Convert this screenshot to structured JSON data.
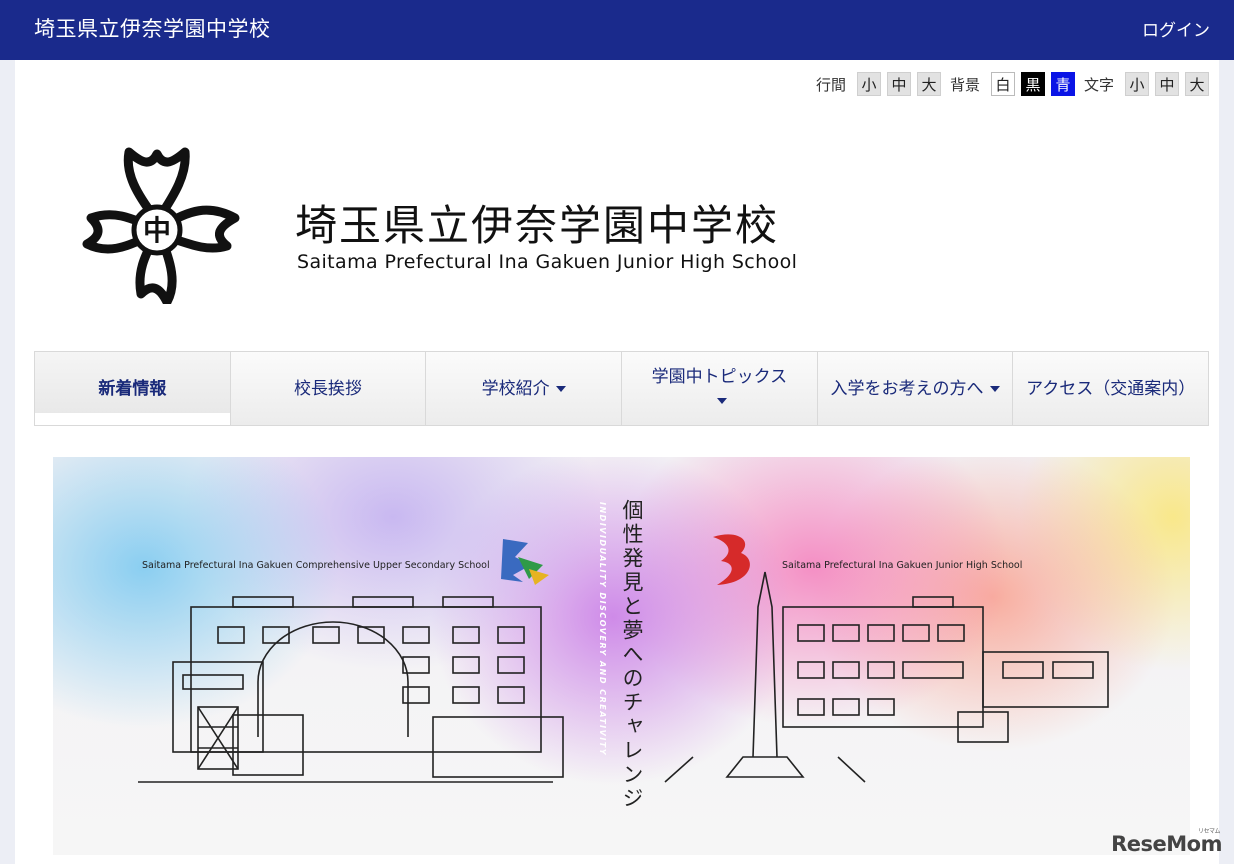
{
  "header": {
    "title": "埼玉県立伊奈学園中学校",
    "login_label": "ログイン"
  },
  "accessibility": {
    "line_spacing_label": "行間",
    "line_spacing_options": [
      "小",
      "中",
      "大"
    ],
    "background_label": "背景",
    "background_options": [
      "白",
      "黒",
      "青"
    ],
    "font_size_label": "文字",
    "font_size_options": [
      "小",
      "中",
      "大"
    ]
  },
  "logo": {
    "name_jp": "埼玉県立伊奈学園中学校",
    "name_en": "Saitama Prefectural Ina Gakuen Junior High School",
    "emblem_char": "中"
  },
  "nav": {
    "items": [
      {
        "label": "新着情報",
        "active": true,
        "dropdown": false
      },
      {
        "label": "校長挨拶",
        "active": false,
        "dropdown": false
      },
      {
        "label": "学校紹介",
        "active": false,
        "dropdown": true
      },
      {
        "label": "学園中トピックス",
        "active": false,
        "dropdown": true
      },
      {
        "label": "入学をお考えの方へ",
        "active": false,
        "dropdown": true
      },
      {
        "label": "アクセス（交通案内）",
        "active": false,
        "dropdown": false
      }
    ]
  },
  "hero": {
    "caption_left": "Saitama Prefectural Ina Gakuen Comprehensive Upper Secondary School",
    "caption_right": "Saitama Prefectural Ina Gakuen Junior High School",
    "vertical_jp": "個性発見と夢へのチャレンジ",
    "vertical_en": "INDIVIDUALITY DISCOVERY AND CREATIVITY"
  },
  "watermark": {
    "text": "ReseMom",
    "sub": "リセマム"
  },
  "colors": {
    "header_bg": "#1a2a8c",
    "nav_text": "#1a2a7a",
    "bg_black": "#000000",
    "bg_blue": "#0a14e6"
  }
}
